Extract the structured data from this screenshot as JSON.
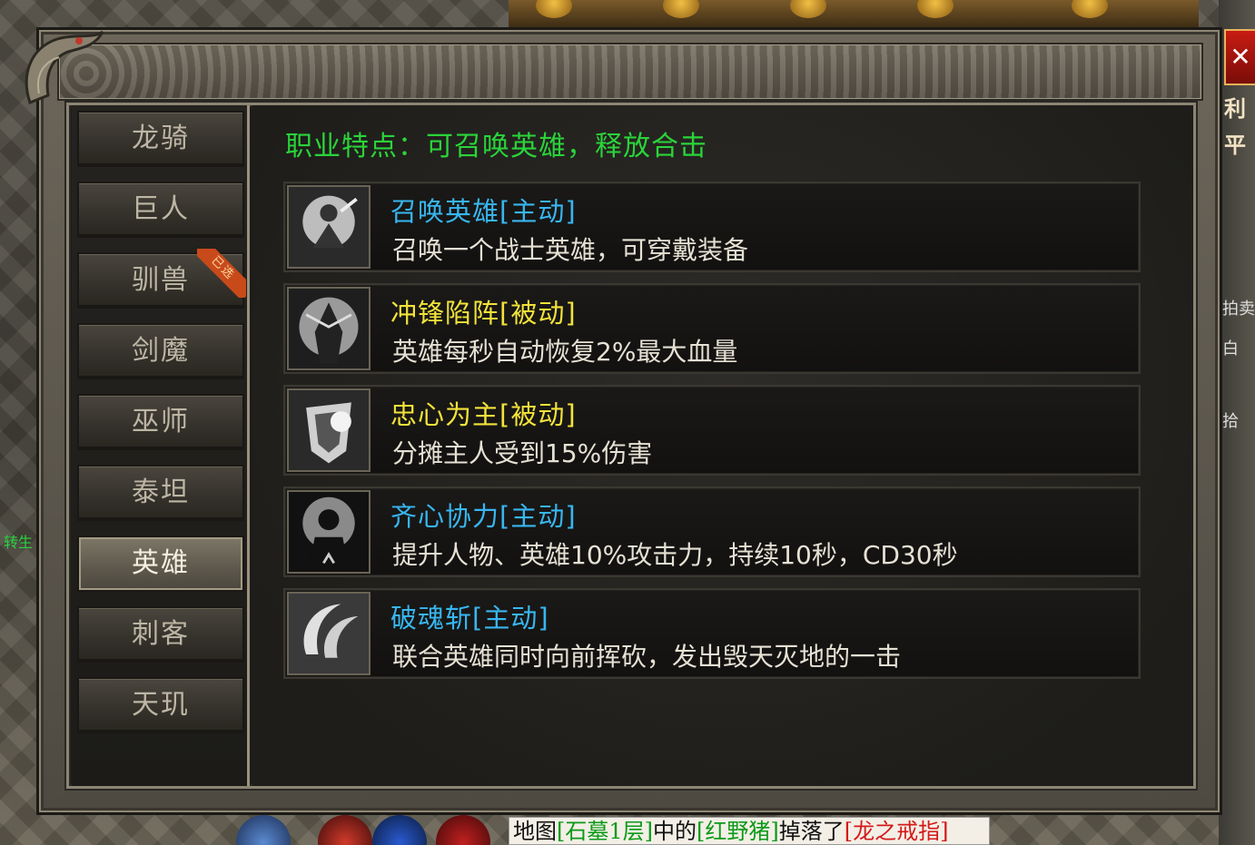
{
  "window": {
    "close_symbol": "✕"
  },
  "sidebar": {
    "items": [
      {
        "label": "龙骑"
      },
      {
        "label": "巨人"
      },
      {
        "label": "驯兽",
        "badge": "已选"
      },
      {
        "label": "剑魔"
      },
      {
        "label": "巫师"
      },
      {
        "label": "泰坦"
      },
      {
        "label": "英雄",
        "active": true
      },
      {
        "label": "刺客"
      },
      {
        "label": "天玑"
      }
    ]
  },
  "content": {
    "trait": "职业特点：可召唤英雄，释放合击",
    "skills": [
      {
        "name": "召唤英雄[主动]",
        "desc": "召唤一个战士英雄，可穿戴装备",
        "color": "#38b6f0",
        "icon": "summon-hero-icon"
      },
      {
        "name": "冲锋陷阵[被动]",
        "desc": "英雄每秒自动恢复2%最大血量",
        "color": "#f2e23a",
        "icon": "charge-icon"
      },
      {
        "name": "忠心为主[被动]",
        "desc": "分摊主人受到15%伤害",
        "color": "#f2e23a",
        "icon": "loyalty-shield-icon"
      },
      {
        "name": "齐心协力[主动]",
        "desc": "提升人物、英雄10%攻击力，持续10秒，CD30秒",
        "color": "#38b6f0",
        "icon": "unity-icon"
      },
      {
        "name": "破魂斩[主动]",
        "desc": "联合英雄同时向前挥砍，发出毁天灭地的一击",
        "color": "#38b6f0",
        "icon": "soul-slash-icon"
      }
    ]
  },
  "background": {
    "side_text": "转生",
    "right_glyphs": [
      "利",
      "平"
    ],
    "right_small": [
      "拍卖",
      "白",
      "拾"
    ],
    "bottom_message": {
      "prefix": "地图",
      "map": "[石墓1层]",
      "mid": "中的",
      "monster": "[红野猪]",
      "verb": "掉落了",
      "item": "[龙之戒指]"
    }
  },
  "colors": {
    "trait_green": "#2ad43a",
    "active_skill_blue": "#38b6f0",
    "passive_skill_yellow": "#f2e23a",
    "close_red": "#c81c12"
  }
}
